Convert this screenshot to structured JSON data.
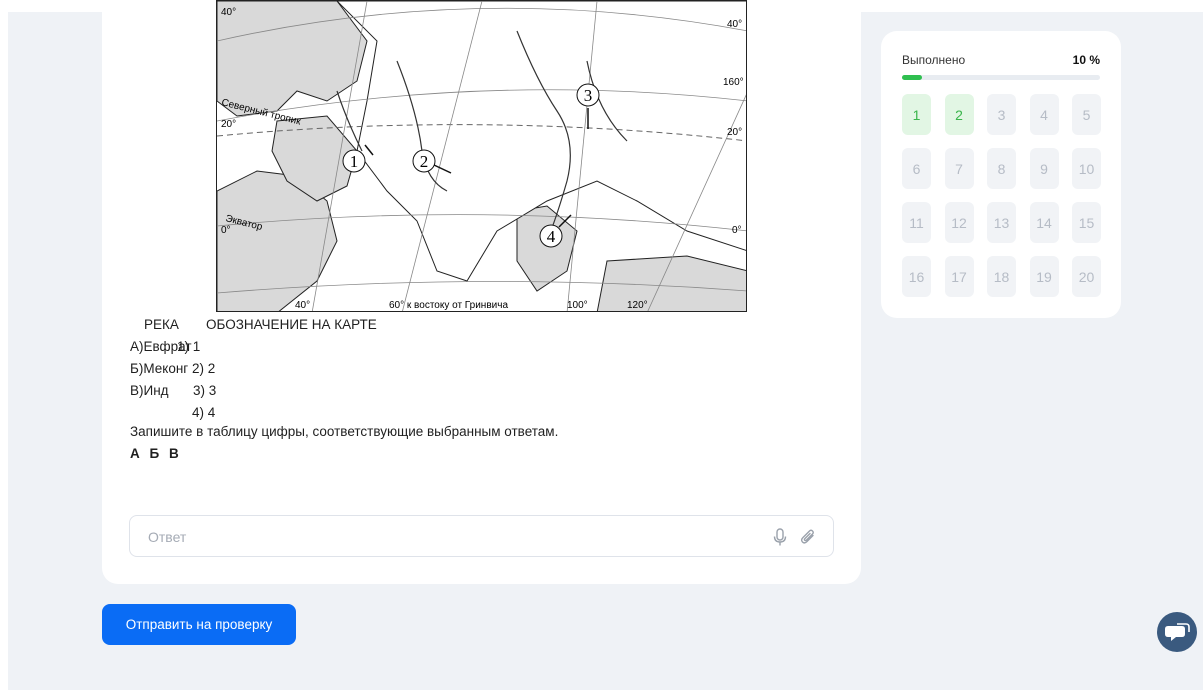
{
  "map": {
    "lat_left": [
      "40°",
      "20°",
      "0°"
    ],
    "lat_right": [
      "40°",
      "160°",
      "20°",
      "0°"
    ],
    "lon_bottom": [
      "40°",
      "60° к востоку от Гринвича",
      "100°",
      "120°"
    ],
    "tropic_label": "Северный тропик",
    "equator_label": "Экватор",
    "markers": [
      "1",
      "2",
      "3",
      "4"
    ]
  },
  "table": {
    "header_river": "РЕКА",
    "header_map": "ОБОЗНАЧЕНИЕ НА КАРТЕ",
    "rows": [
      {
        "river": "А)Евфрат",
        "option": "1) 1"
      },
      {
        "river": "Б)Меконг",
        "option": "2) 2"
      },
      {
        "river": "В)Инд",
        "option": "3) 3"
      },
      {
        "river": "",
        "option": "4) 4"
      }
    ]
  },
  "instruction": "Запишите в таблицу цифры, соответствующие выбранным ответам.",
  "answer_columns": "А Б В",
  "answer": {
    "placeholder": "Ответ",
    "value": ""
  },
  "icons": {
    "mic": "microphone-icon",
    "attach": "paperclip-icon",
    "chat": "chat-bubble-icon"
  },
  "submit_label": "Отправить на проверку",
  "progress": {
    "label": "Выполнено",
    "percent_text": "10 %",
    "fraction": 0.1,
    "questions": [
      "1",
      "2",
      "3",
      "4",
      "5",
      "6",
      "7",
      "8",
      "9",
      "10",
      "11",
      "12",
      "13",
      "14",
      "15",
      "16",
      "17",
      "18",
      "19",
      "20"
    ],
    "completed": [
      "1",
      "2"
    ]
  },
  "colors": {
    "accent": "#0a6cf5",
    "done_bg": "#e2f6e4",
    "done_text": "#39b54a",
    "progress_fill": "#2fbf4f"
  }
}
